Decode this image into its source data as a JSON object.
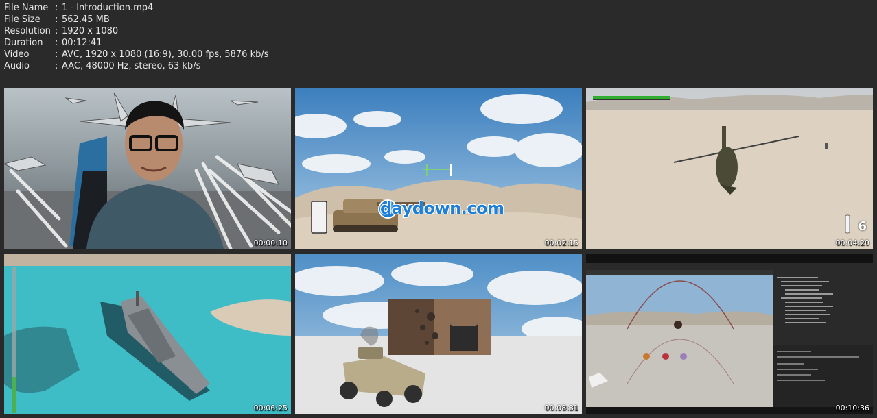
{
  "info": [
    {
      "key": "File Name",
      "sep": ":",
      "value": "1 - Introduction.mp4"
    },
    {
      "key": "File Size",
      "sep": ":",
      "value": "562.45 MB"
    },
    {
      "key": "Resolution",
      "sep": ":",
      "value": "1920 x 1080"
    },
    {
      "key": "Duration",
      "sep": ":",
      "value": "00:12:41"
    },
    {
      "key": "Video",
      "sep": ":",
      "value": "AVC, 1920 x 1080 (16:9), 30.00 fps, 5876 kb/s"
    },
    {
      "key": "Audio",
      "sep": ":",
      "value": "AAC, 48000 Hz, stereo, 63 kb/s"
    }
  ],
  "thumbs": [
    {
      "timestamp": "00:00:10"
    },
    {
      "timestamp": "00:02:15",
      "watermark": "daydown.com"
    },
    {
      "timestamp": "00:04:20",
      "ammo": "6"
    },
    {
      "timestamp": "00:06:25"
    },
    {
      "timestamp": "00:08:31"
    },
    {
      "timestamp": "00:10:36"
    }
  ]
}
